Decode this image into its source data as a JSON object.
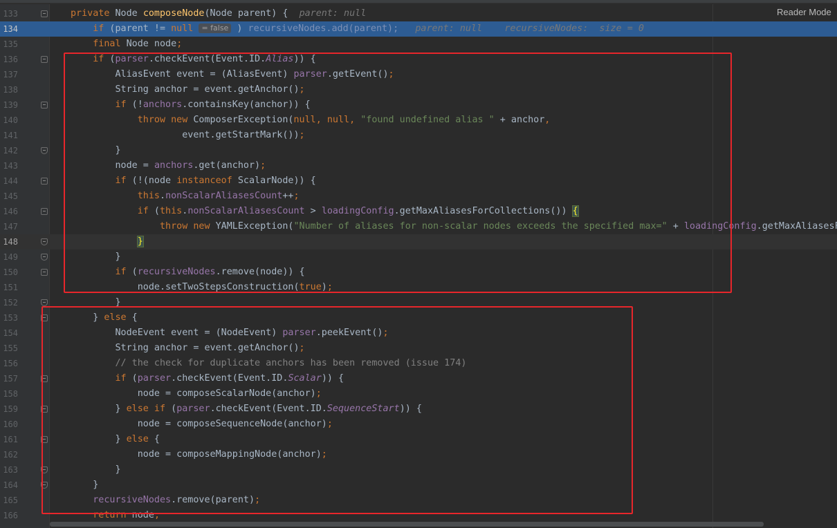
{
  "reader_mode_label": "Reader Mode",
  "colors": {
    "background": "#2b2b2b",
    "gutter": "#313335",
    "debug_line": "#2d5c93",
    "annotation_box": "#e8262b"
  },
  "lines": [
    {
      "n": "133",
      "html": "<span class=\"kw\">private</span> Node <span class=\"fn\">composeNode</span>(Node parent) {  <span class=\"hint\">parent: null</span>"
    },
    {
      "n": "134",
      "html": "    <span class=\"kw\">if</span> (parent != <span class=\"kw\">null</span> <span class=\"chip\">= false</span> ) <span class=\"dim\">recursiveNodes.add(parent);</span>   <span class=\"hint\">parent: null    recursiveNodes:  size = 0</span>"
    },
    {
      "n": "135",
      "html": "    <span class=\"kw\">final</span> Node node<span class=\"kw\">;</span>"
    },
    {
      "n": "136",
      "html": "    <span class=\"kw\">if</span> (<span class=\"fld\">parser</span>.checkEvent(Event.ID.<span class=\"it\">Alias</span>)) {"
    },
    {
      "n": "137",
      "html": "        AliasEvent event = (AliasEvent) <span class=\"fld\">parser</span>.getEvent()<span class=\"kw\">;</span>"
    },
    {
      "n": "138",
      "html": "        String anchor = event.getAnchor()<span class=\"kw\">;</span>"
    },
    {
      "n": "139",
      "html": "        <span class=\"kw\">if</span> (!<span class=\"fld\">anchors</span>.containsKey(anchor)) {"
    },
    {
      "n": "140",
      "html": "            <span class=\"kw\">throw new</span> ComposerException(<span class=\"kw\">null, null, </span><span class=\"str\">\"found undefined alias \"</span> + anchor<span class=\"kw\">,</span>"
    },
    {
      "n": "141",
      "html": "                    event.getStartMark())<span class=\"kw\">;</span>"
    },
    {
      "n": "142",
      "html": "        }"
    },
    {
      "n": "143",
      "html": "        node = <span class=\"fld\">anchors</span>.get(anchor)<span class=\"kw\">;</span>"
    },
    {
      "n": "144",
      "html": "        <span class=\"kw\">if</span> (!(node <span class=\"kw\">instanceof</span> ScalarNode)) {"
    },
    {
      "n": "145",
      "html": "            <span class=\"kw\">this</span>.<span class=\"fld\">nonScalarAliasesCount</span>++<span class=\"kw\">;</span>"
    },
    {
      "n": "146",
      "html": "            <span class=\"kw\">if</span> (<span class=\"kw\">this</span>.<span class=\"fld\">nonScalarAliasesCount</span> > <span class=\"fld\">loadingConfig</span>.getMaxAliasesForCollections()) <span class=\"brace-match\">{</span>"
    },
    {
      "n": "147",
      "html": "                <span class=\"kw\">throw new</span> YAMLException(<span class=\"str\">\"Number of aliases for non-scalar nodes exceeds the specified max=\"</span> + <span class=\"fld\">loadingConfig</span>.getMaxAliasesForCollections())<span class=\"kw\">;</span>"
    },
    {
      "n": "148",
      "html": "            <span class=\"brace-match\">}</span>"
    },
    {
      "n": "149",
      "html": "        }"
    },
    {
      "n": "150",
      "html": "        <span class=\"kw\">if</span> (<span class=\"fld\">recursiveNodes</span>.remove(node)) {"
    },
    {
      "n": "151",
      "html": "            node.setTwoStepsConstruction(<span class=\"kw\">true</span>)<span class=\"kw\">;</span>"
    },
    {
      "n": "152",
      "html": "        }"
    },
    {
      "n": "153",
      "html": "    } <span class=\"kw\">else</span> {"
    },
    {
      "n": "154",
      "html": "        NodeEvent event = (NodeEvent) <span class=\"fld\">parser</span>.peekEvent()<span class=\"kw\">;</span>"
    },
    {
      "n": "155",
      "html": "        String anchor = event.getAnchor()<span class=\"kw\">;</span>"
    },
    {
      "n": "156",
      "html": "        <span class=\"cmt\">// the check for duplicate anchors has been removed (issue 174)</span>"
    },
    {
      "n": "157",
      "html": "        <span class=\"kw\">if</span> (<span class=\"fld\">parser</span>.checkEvent(Event.ID.<span class=\"it\">Scalar</span>)) {"
    },
    {
      "n": "158",
      "html": "            node = composeScalarNode(anchor)<span class=\"kw\">;</span>"
    },
    {
      "n": "159",
      "html": "        } <span class=\"kw\">else if</span> (<span class=\"fld\">parser</span>.checkEvent(Event.ID.<span class=\"it\">SequenceStart</span>)) {"
    },
    {
      "n": "160",
      "html": "            node = composeSequenceNode(anchor)<span class=\"kw\">;</span>"
    },
    {
      "n": "161",
      "html": "        } <span class=\"kw\">else</span> {"
    },
    {
      "n": "162",
      "html": "            node = composeMappingNode(anchor)<span class=\"kw\">;</span>"
    },
    {
      "n": "163",
      "html": "        }"
    },
    {
      "n": "164",
      "html": "    }"
    },
    {
      "n": "165",
      "html": "    <span class=\"fld\">recursiveNodes</span>.remove(parent)<span class=\"kw\">;</span>"
    },
    {
      "n": "166",
      "html": "    <span class=\"kw\">return</span> node<span class=\"kw\">;</span>"
    }
  ]
}
